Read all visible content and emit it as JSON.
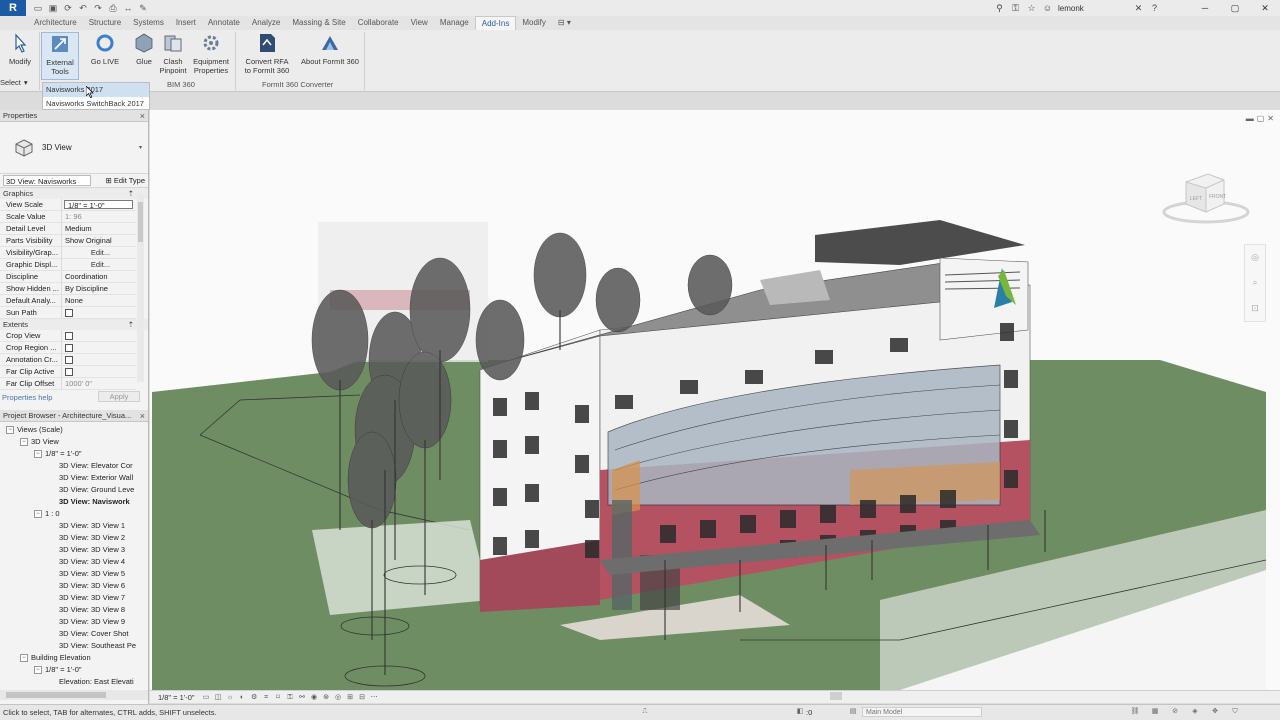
{
  "app": {
    "logo_letter": "R"
  },
  "titlebar": {
    "user": "lemonk",
    "search_icon": "binoculars-icon",
    "min": "─",
    "max": "▢",
    "close": "✕"
  },
  "menu": {
    "tabs": [
      "Architecture",
      "Structure",
      "Systems",
      "Insert",
      "Annotate",
      "Analyze",
      "Massing & Site",
      "Collaborate",
      "View",
      "Manage",
      "Add-Ins",
      "Modify"
    ],
    "active": "Add-Ins"
  },
  "ribbon": {
    "modify": "Modify",
    "select": "Select",
    "external_tools_1": "External",
    "external_tools_2": "Tools",
    "go_live": "Go LIVE",
    "glue": "Glue",
    "clash_1": "Clash",
    "clash_2": "Pinpoint",
    "equip_1": "Equipment",
    "equip_2": "Properties",
    "convert_1": "Convert RFA",
    "convert_2": "to FormIt 360",
    "about_formit": "About FormIt 360",
    "panel_bim360": "BIM 360",
    "panel_formit": "FormIt 360 Converter"
  },
  "dropdown": {
    "items": [
      "Navisworks 2017",
      "Navisworks SwitchBack 2017"
    ]
  },
  "properties": {
    "header": "Properties",
    "type_name": "3D View",
    "instance": "3D View: Navisworks",
    "edit_type": "Edit Type",
    "graphics": "Graphics",
    "extents": "Extents",
    "rows": [
      {
        "name": "View Scale",
        "value": "1/8\" = 1'-0\""
      },
      {
        "name": "Scale Value",
        "value": "1:  96"
      },
      {
        "name": "Detail Level",
        "value": "Medium"
      },
      {
        "name": "Parts Visibility",
        "value": "Show Original"
      },
      {
        "name": "Visibility/Grap...",
        "value": "Edit..."
      },
      {
        "name": "Graphic Displ...",
        "value": "Edit..."
      },
      {
        "name": "Discipline",
        "value": "Coordination"
      },
      {
        "name": "Show Hidden ...",
        "value": "By Discipline"
      },
      {
        "name": "Default Analy...",
        "value": "None"
      },
      {
        "name": "Sun Path",
        "value": ""
      }
    ],
    "extent_rows": [
      {
        "name": "Crop View"
      },
      {
        "name": "Crop Region ..."
      },
      {
        "name": "Annotation Cr..."
      },
      {
        "name": "Far Clip Active"
      },
      {
        "name": "Far Clip Offset",
        "value": "1000' 0\""
      }
    ],
    "help": "Properties help",
    "apply": "Apply"
  },
  "browser": {
    "header": "Project Browser - Architecture_Visua...",
    "nodes": [
      {
        "label": "Views (Scale)",
        "indent": 0,
        "toggle": "−",
        "bold": false
      },
      {
        "label": "3D View",
        "indent": 1,
        "toggle": "−",
        "bold": false
      },
      {
        "label": "1/8\" = 1'-0\"",
        "indent": 2,
        "toggle": "−",
        "bold": false
      },
      {
        "label": "3D View: Elevator Cor",
        "indent": 3,
        "toggle": "",
        "bold": false
      },
      {
        "label": "3D View: Exterior Wall",
        "indent": 3,
        "toggle": "",
        "bold": false
      },
      {
        "label": "3D View: Ground Leve",
        "indent": 3,
        "toggle": "",
        "bold": false
      },
      {
        "label": "3D View: Naviswork",
        "indent": 3,
        "toggle": "",
        "bold": true
      },
      {
        "label": "1 : 0",
        "indent": 2,
        "toggle": "−",
        "bold": false
      },
      {
        "label": "3D View: 3D View 1",
        "indent": 3,
        "toggle": "",
        "bold": false
      },
      {
        "label": "3D View: 3D View 2",
        "indent": 3,
        "toggle": "",
        "bold": false
      },
      {
        "label": "3D View: 3D View 3",
        "indent": 3,
        "toggle": "",
        "bold": false
      },
      {
        "label": "3D View: 3D View 4",
        "indent": 3,
        "toggle": "",
        "bold": false
      },
      {
        "label": "3D View: 3D View 5",
        "indent": 3,
        "toggle": "",
        "bold": false
      },
      {
        "label": "3D View: 3D View 6",
        "indent": 3,
        "toggle": "",
        "bold": false
      },
      {
        "label": "3D View: 3D View 7",
        "indent": 3,
        "toggle": "",
        "bold": false
      },
      {
        "label": "3D View: 3D View 8",
        "indent": 3,
        "toggle": "",
        "bold": false
      },
      {
        "label": "3D View: 3D View 9",
        "indent": 3,
        "toggle": "",
        "bold": false
      },
      {
        "label": "3D View: Cover Shot",
        "indent": 3,
        "toggle": "",
        "bold": false
      },
      {
        "label": "3D View: Southeast Pe",
        "indent": 3,
        "toggle": "",
        "bold": false
      },
      {
        "label": "Building Elevation",
        "indent": 1,
        "toggle": "−",
        "bold": false
      },
      {
        "label": "1/8\" = 1'-0\"",
        "indent": 2,
        "toggle": "−",
        "bold": false
      },
      {
        "label": "Elevation: East Elevati",
        "indent": 3,
        "toggle": "",
        "bold": false
      }
    ]
  },
  "viewcube": {
    "left": "LEFT",
    "front": "FRONT"
  },
  "view_control": {
    "scale": "1/8\" = 1'-0\""
  },
  "status": {
    "text": "Click to select, TAB for alternates, CTRL adds, SHIFT unselects.",
    "coord": ":0",
    "model": "Main Model"
  }
}
